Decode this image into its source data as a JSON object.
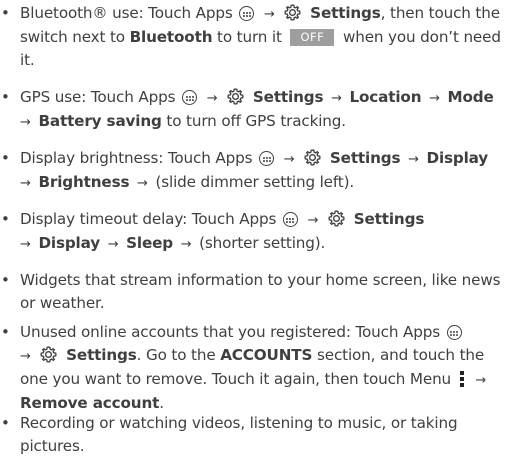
{
  "items": [
    {
      "bluetooth_prefix": "Bluetooth® use: Touch Apps",
      "arrow": "→",
      "settings": "Settings",
      "mid": ", then touch the switch next to ",
      "bluetooth": "Bluetooth",
      "turn_it": " to turn it",
      "off_label": "OFF",
      "suffix": " when you don’t need it."
    },
    {
      "prefix": "GPS use: Touch Apps",
      "settings": "Settings",
      "location": "Location",
      "mode": "Mode",
      "battery": "Battery saving",
      "suffix": " to turn off GPS tracking."
    },
    {
      "prefix": "Display brightness: Touch Apps",
      "settings": "Settings",
      "display": "Display",
      "brightness": "Brightness",
      "suffix": " (slide dimmer setting left)."
    },
    {
      "prefix": "Display timeout delay: Touch Apps",
      "settings": "Settings",
      "display": "Display",
      "sleep": "Sleep",
      "suffix": " (shorter setting)."
    },
    {
      "text": "Widgets that stream information to your home screen, like news or weather."
    },
    {
      "prefix": "Unused online accounts that you registered: Touch Apps",
      "settings": "Settings",
      "go_to": ". Go to the ",
      "accounts": "ACCOUNTS",
      "section": " section, and touch the one you want to remove. Touch it again, then touch Menu",
      "remove": "Remove account",
      "end": "."
    },
    {
      "text": "Recording or watching videos, listening to music, or taking pictures."
    }
  ],
  "bullet": "•",
  "icons": {
    "apps": "apps-icon",
    "settings": "settings-gear-icon",
    "menu": "menu-icon"
  },
  "colors": {
    "text": "#3f3f3f",
    "toggle_off_bg": "#9e9e9e"
  }
}
